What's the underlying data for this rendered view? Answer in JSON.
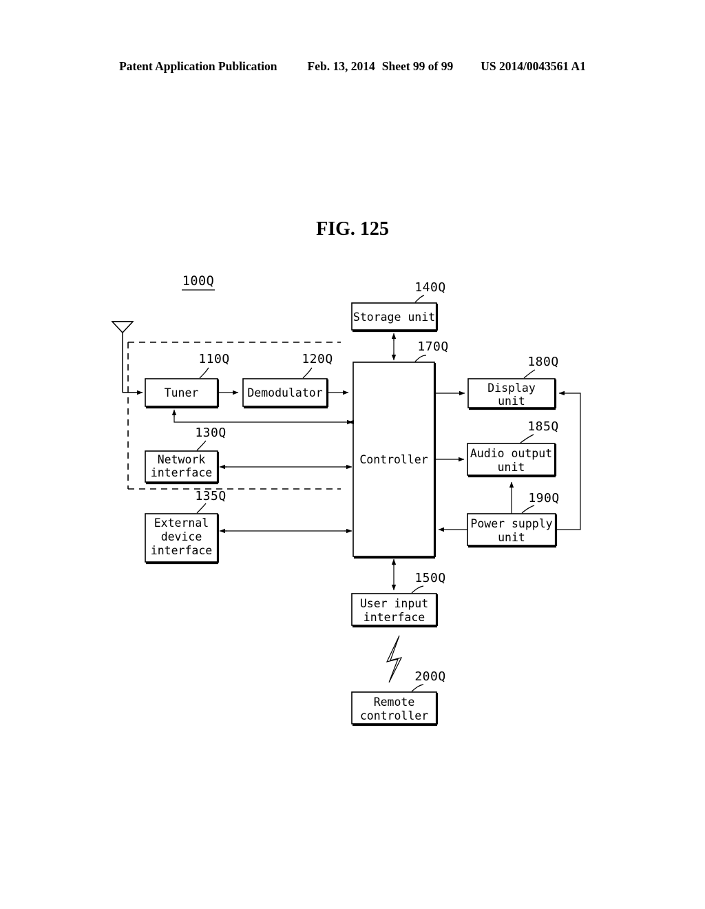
{
  "header": {
    "publication": "Patent Application Publication",
    "date": "Feb. 13, 2014",
    "sheet": "Sheet 99 of 99",
    "patent_number": "US 2014/0043561 A1"
  },
  "figure": {
    "title": "FIG. 125",
    "system_ref": "100Q"
  },
  "diagram": {
    "type": "block-diagram",
    "blocks": [
      {
        "id": "tuner",
        "ref": "110Q",
        "label": "Tuner"
      },
      {
        "id": "demodulator",
        "ref": "120Q",
        "label": "Demodulator"
      },
      {
        "id": "network",
        "ref": "130Q",
        "label_line1": "Network",
        "label_line2": "interface"
      },
      {
        "id": "external",
        "ref": "135Q",
        "label_line1": "External",
        "label_line2": "device",
        "label_line3": "interface"
      },
      {
        "id": "storage",
        "ref": "140Q",
        "label": "Storage unit"
      },
      {
        "id": "userinput",
        "ref": "150Q",
        "label_line1": "User input",
        "label_line2": "interface"
      },
      {
        "id": "controller",
        "ref": "170Q",
        "label": "Controller"
      },
      {
        "id": "display",
        "ref": "180Q",
        "label_line1": "Display",
        "label_line2": "unit"
      },
      {
        "id": "audio",
        "ref": "185Q",
        "label_line1": "Audio output",
        "label_line2": "unit"
      },
      {
        "id": "power",
        "ref": "190Q",
        "label_line1": "Power supply",
        "label_line2": "unit"
      },
      {
        "id": "remote",
        "ref": "200Q",
        "label_line1": "Remote",
        "label_line2": "controller"
      }
    ],
    "icons": [
      {
        "id": "antenna",
        "name": "antenna-icon"
      },
      {
        "id": "wireless-link",
        "name": "lightning-bolt-icon"
      }
    ]
  },
  "colors": {
    "ink": "#000000",
    "paper": "#ffffff"
  }
}
